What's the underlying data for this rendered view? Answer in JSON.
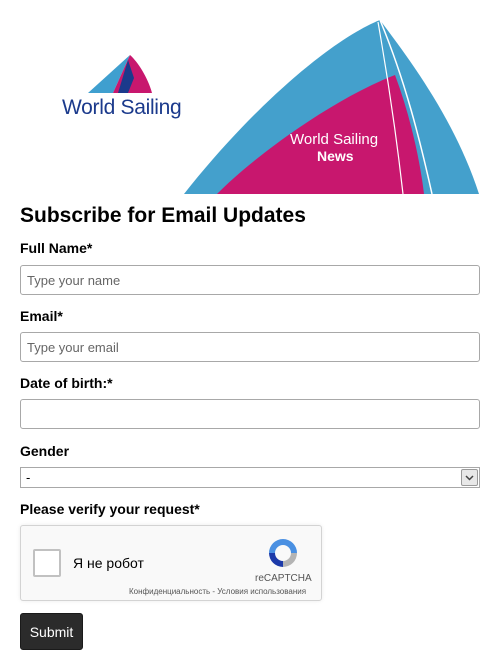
{
  "header": {
    "logo_text": "World Sailing",
    "news_line1": "World Sailing",
    "news_line2": "News"
  },
  "form": {
    "title": "Subscribe for Email Updates",
    "full_name": {
      "label": "Full Name*",
      "placeholder": "Type your name",
      "value": ""
    },
    "email": {
      "label": "Email*",
      "placeholder": "Type your email",
      "value": ""
    },
    "dob": {
      "label": "Date of birth:*",
      "value": ""
    },
    "gender": {
      "label": "Gender",
      "selected": "-"
    },
    "verify": {
      "label": "Please verify your request*"
    },
    "submit_label": "Submit"
  },
  "captcha": {
    "label": "Я не робот",
    "brand": "reCAPTCHA",
    "links": "Конфиденциальность - Условия использования"
  },
  "colors": {
    "brand_blue": "#3f9fcf",
    "brand_pink": "#c8176e",
    "logo_text": "#1b3a8c",
    "button_bg": "#2b2b2b"
  }
}
